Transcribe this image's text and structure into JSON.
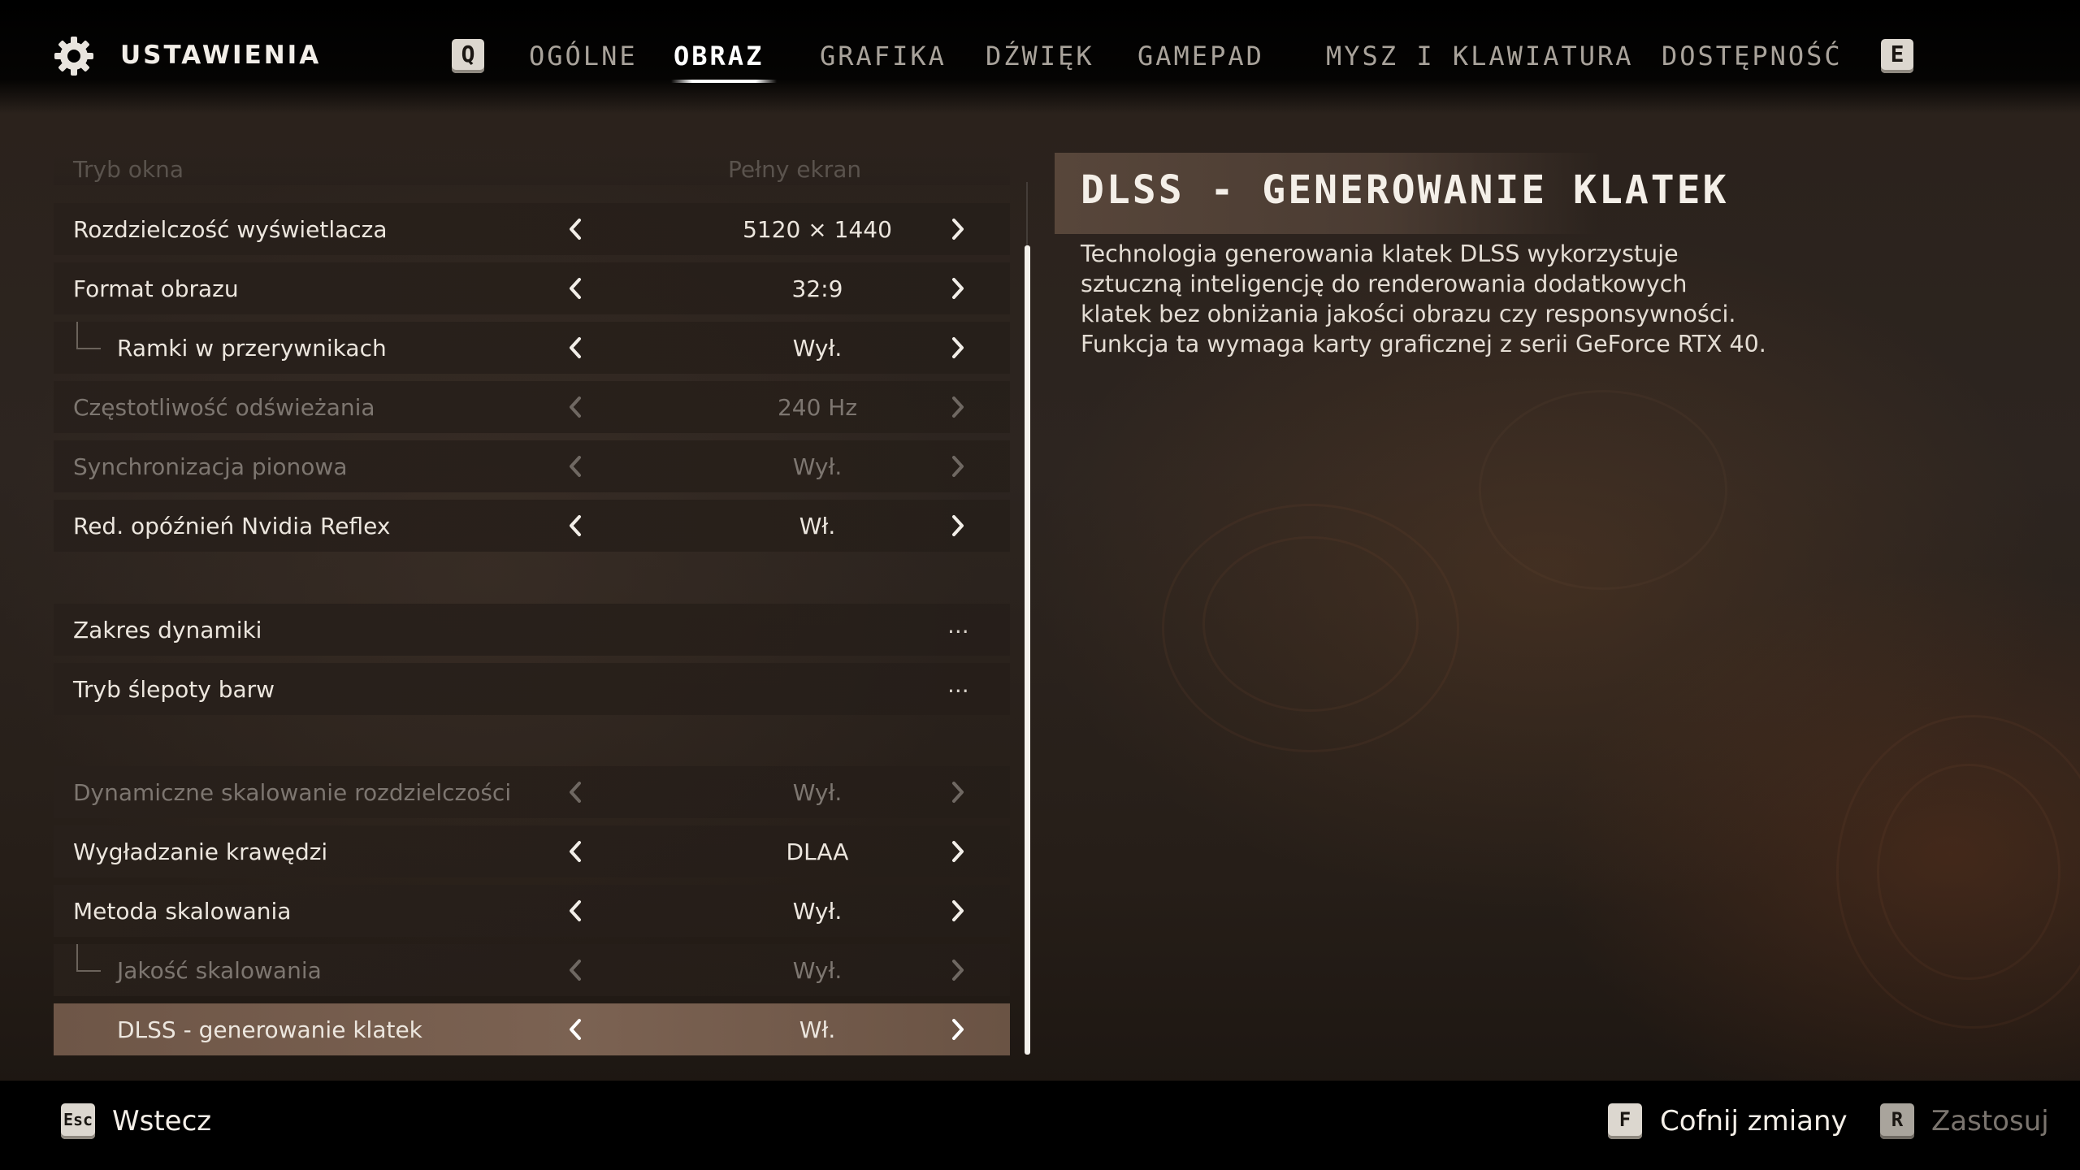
{
  "header": {
    "title": "USTAWIENIA",
    "prev_key": "Q",
    "next_key": "E",
    "tabs": [
      {
        "label": "OGÓLNE",
        "active": false
      },
      {
        "label": "OBRAZ",
        "active": true
      },
      {
        "label": "GRAFIKA",
        "active": false
      },
      {
        "label": "DŹWIĘK",
        "active": false
      },
      {
        "label": "GAMEPAD",
        "active": false
      },
      {
        "label": "MYSZ I KLAWIATURA",
        "active": false
      },
      {
        "label": "DOSTĘPNOŚĆ",
        "active": false
      }
    ]
  },
  "settings": {
    "partially_hidden_row": {
      "label": "Tryb okna",
      "value": "Pełny ekran"
    },
    "rows": [
      {
        "label": "Rozdzielczość wyświetlacza",
        "value": "5120 × 1440",
        "state": "enabled"
      },
      {
        "label": "Format obrazu",
        "value": "32:9",
        "state": "enabled"
      },
      {
        "label": "Ramki w przerywnikach",
        "value": "Wył.",
        "state": "enabled",
        "sub": true
      },
      {
        "label": "Częstotliwość odświeżania",
        "value": "240 Hz",
        "state": "disabled"
      },
      {
        "label": "Synchronizacja pionowa",
        "value": "Wył.",
        "state": "disabled"
      },
      {
        "label": "Red. opóźnień Nvidia Reflex",
        "value": "Wł.",
        "state": "enabled"
      },
      {
        "label": "Zakres dynamiki",
        "value": "...",
        "state": "enabled",
        "type": "submenu"
      },
      {
        "label": "Tryb ślepoty barw",
        "value": "...",
        "state": "enabled",
        "type": "submenu"
      },
      {
        "label": "Dynamiczne skalowanie rozdzielczości",
        "value": "Wył.",
        "state": "disabled"
      },
      {
        "label": "Wygładzanie krawędzi",
        "value": "DLAA",
        "state": "enabled"
      },
      {
        "label": "Metoda skalowania",
        "value": "Wył.",
        "state": "enabled"
      },
      {
        "label": "Jakość skalowania",
        "value": "Wył.",
        "state": "disabled",
        "sub": true
      },
      {
        "label": "DLSS - generowanie klatek",
        "value": "Wł.",
        "state": "selected",
        "sub": true
      }
    ]
  },
  "description": {
    "title": "DLSS - GENEROWANIE KLATEK",
    "lines": [
      "Technologia generowania klatek DLSS wykorzystuje",
      "sztuczną inteligencję do renderowania dodatkowych",
      "klatek bez obniżania jakości obrazu czy responsywności.",
      "Funkcja ta wymaga karty graficznej z serii GeForce RTX 40."
    ]
  },
  "footer": {
    "back": {
      "key": "Esc",
      "label": "Wstecz"
    },
    "revert": {
      "key": "F",
      "label": "Cofnij zmiany"
    },
    "apply": {
      "key": "R",
      "label": "Zastosuj",
      "enabled": false
    }
  },
  "colors": {
    "selected_row": "#7b6252",
    "disabled_text": "#7d7670",
    "accent_white": "#ffffff"
  }
}
